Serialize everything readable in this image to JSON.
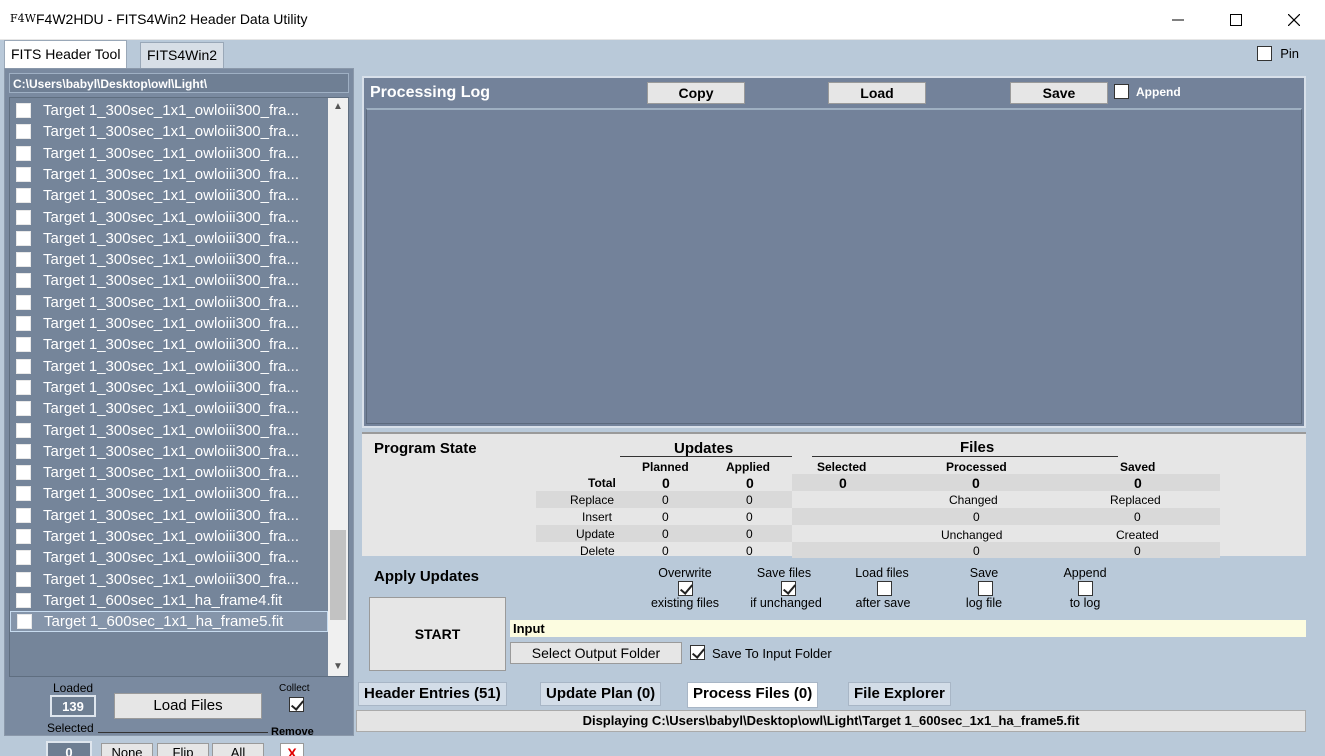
{
  "window": {
    "logo": "F4W",
    "title": "F4W2HDU - FITS4Win2 Header Data Utility"
  },
  "main_tabs": [
    "FITS Header Tool",
    "FITS4Win2"
  ],
  "pin_label": "Pin",
  "left": {
    "path": "C:\\Users\\babyl\\Desktop\\owl\\Light\\",
    "files": [
      "Target 1_300sec_1x1_owloiii300_fra...",
      "Target 1_300sec_1x1_owloiii300_fra...",
      "Target 1_300sec_1x1_owloiii300_fra...",
      "Target 1_300sec_1x1_owloiii300_fra...",
      "Target 1_300sec_1x1_owloiii300_fra...",
      "Target 1_300sec_1x1_owloiii300_fra...",
      "Target 1_300sec_1x1_owloiii300_fra...",
      "Target 1_300sec_1x1_owloiii300_fra...",
      "Target 1_300sec_1x1_owloiii300_fra...",
      "Target 1_300sec_1x1_owloiii300_fra...",
      "Target 1_300sec_1x1_owloiii300_fra...",
      "Target 1_300sec_1x1_owloiii300_fra...",
      "Target 1_300sec_1x1_owloiii300_fra...",
      "Target 1_300sec_1x1_owloiii300_fra...",
      "Target 1_300sec_1x1_owloiii300_fra...",
      "Target 1_300sec_1x1_owloiii300_fra...",
      "Target 1_300sec_1x1_owloiii300_fra...",
      "Target 1_300sec_1x1_owloiii300_fra...",
      "Target 1_300sec_1x1_owloiii300_fra...",
      "Target 1_300sec_1x1_owloiii300_fra...",
      "Target 1_300sec_1x1_owloiii300_fra...",
      "Target 1_300sec_1x1_owloiii300_fra...",
      "Target 1_300sec_1x1_owloiii300_fra...",
      "Target 1_600sec_1x1_ha_frame4.fit",
      "Target 1_600sec_1x1_ha_frame5.fit"
    ],
    "loaded_label": "Loaded",
    "loaded_count": "139",
    "selected_label": "Selected",
    "selected_count": "0",
    "load_files": "Load Files",
    "collect_label": "Collect",
    "remove_label": "Remove",
    "none_btn": "None",
    "flip_btn": "Flip",
    "all_btn": "All",
    "x_btn": "X"
  },
  "log": {
    "title": "Processing Log",
    "copy": "Copy",
    "load": "Load",
    "save": "Save",
    "append": "Append"
  },
  "state": {
    "title": "Program State",
    "updates_hdr": "Updates",
    "files_hdr": "Files",
    "planned": "Planned",
    "applied": "Applied",
    "selected": "Selected",
    "processed": "Processed",
    "saved": "Saved",
    "rows": [
      "Total",
      "Replace",
      "Insert",
      "Update",
      "Delete"
    ],
    "planned_vals": [
      "0",
      "0",
      "0",
      "0",
      "0"
    ],
    "applied_vals": [
      "0",
      "0",
      "0",
      "0",
      "0"
    ],
    "selected_total": "0",
    "processed_total": "0",
    "saved_total": "0",
    "changed_label": "Changed",
    "changed_val": "0",
    "unchanged_label": "Unchanged",
    "unchanged_val": "0",
    "replaced_label": "Replaced",
    "replaced_val": "0",
    "created_label": "Created",
    "created_val": "0"
  },
  "apply": {
    "title": "Apply Updates",
    "start": "START",
    "opt1_top": "Overwrite",
    "opt1_bot": "existing files",
    "opt2_top": "Save files",
    "opt2_bot": "if unchanged",
    "opt3_top": "Load files",
    "opt3_bot": "after save",
    "opt4_top": "Save",
    "opt4_bot": "log file",
    "opt5_top": "Append",
    "opt5_bot": "to log",
    "input_label": "Input",
    "select_output": "Select Output Folder",
    "save_to_input": "Save To Input Folder"
  },
  "bottom_tabs": [
    "Header Entries (51)",
    "Update Plan (0)",
    "Process Files (0)",
    "File Explorer"
  ],
  "status": "Displaying C:\\Users\\babyl\\Desktop\\owl\\Light\\Target 1_600sec_1x1_ha_frame5.fit"
}
